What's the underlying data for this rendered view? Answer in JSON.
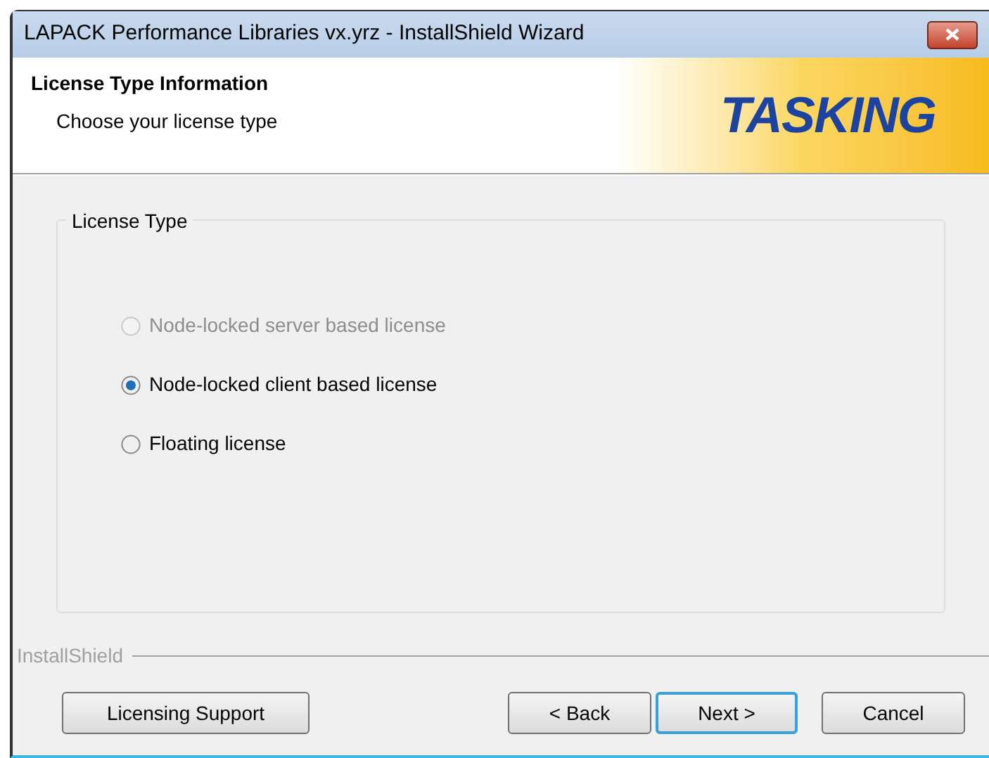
{
  "window": {
    "title": "LAPACK Performance Libraries vx.yrz - InstallShield Wizard"
  },
  "header": {
    "title": "License Type Information",
    "subtitle": "Choose your license type",
    "logo": "TASKING"
  },
  "group": {
    "label": "License Type",
    "options": [
      {
        "label": "Node-locked server based license",
        "selected": false,
        "disabled": true
      },
      {
        "label": "Node-locked client based license",
        "selected": true,
        "disabled": false
      },
      {
        "label": "Floating license",
        "selected": false,
        "disabled": false
      }
    ]
  },
  "brand": "InstallShield",
  "buttons": [
    {
      "label": "Licensing Support",
      "default": false
    },
    {
      "label": "< Back",
      "default": false
    },
    {
      "label": "Next >",
      "default": true
    },
    {
      "label": "Cancel",
      "default": false
    }
  ]
}
